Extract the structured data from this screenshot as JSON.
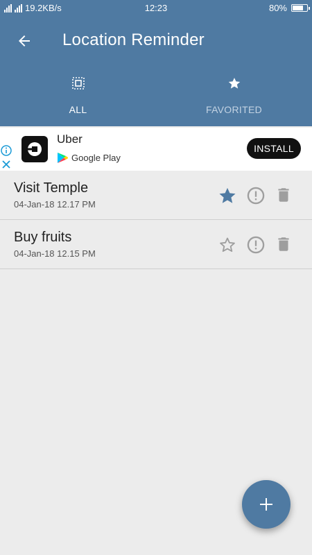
{
  "status_bar": {
    "network_speed": "19.2KB/s",
    "time": "12:23",
    "battery": "80%",
    "battery_level": 0.8
  },
  "toolbar": {
    "title": "Location Reminder",
    "back_icon": "arrow-back-icon"
  },
  "tabs": [
    {
      "label": "ALL",
      "icon": "select-all-icon",
      "active": true
    },
    {
      "label": "FAVORITED",
      "icon": "star-icon",
      "active": false
    }
  ],
  "ad": {
    "app_name": "Uber",
    "store_name": "Google Play",
    "install_label": "INSTALL"
  },
  "reminders": [
    {
      "title": "Visit Temple",
      "date": "04-Jan-18 12.17 PM",
      "favorited": true
    },
    {
      "title": "Buy fruits",
      "date": "04-Jan-18 12.15 PM",
      "favorited": false
    }
  ],
  "fab": {
    "icon": "plus-icon"
  },
  "colors": {
    "primary": "#4f7aa2",
    "background": "#ececec",
    "icon_gray": "#9e9e9e"
  }
}
